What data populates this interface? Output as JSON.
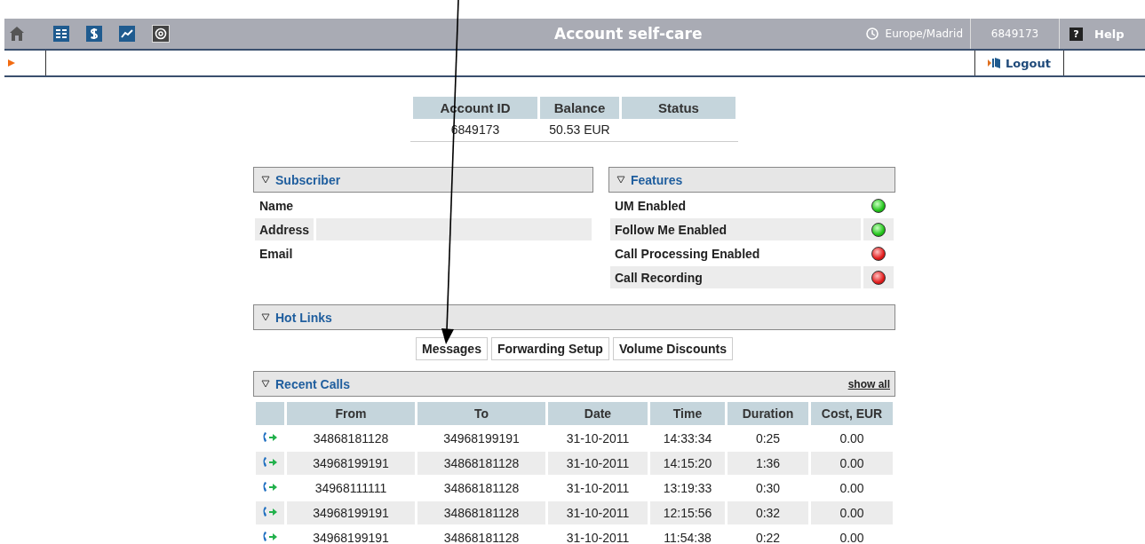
{
  "top_bar": {
    "title": "Account self-care",
    "timezone": "Europe/Madrid",
    "account": "6849173",
    "help_icon": "?",
    "help": "Help"
  },
  "nav_bar": {
    "logout": "Logout"
  },
  "summary": {
    "columns": [
      "Account ID",
      "Balance",
      "Status"
    ],
    "values": [
      "6849173",
      "50.53 EUR"
    ]
  },
  "subscriber": {
    "title": "Subscriber",
    "fields": [
      "Name",
      "Address",
      "Email"
    ]
  },
  "features": {
    "title": "Features",
    "items": [
      {
        "label": "UM Enabled",
        "enabled": true
      },
      {
        "label": "Follow Me Enabled",
        "enabled": true
      },
      {
        "label": "Call Processing Enabled",
        "enabled": false
      },
      {
        "label": "Call Recording",
        "enabled": false
      }
    ]
  },
  "hot_links": {
    "title": "Hot Links",
    "links": [
      "Messages",
      "Forwarding Setup",
      "Volume Discounts"
    ]
  },
  "recent_calls": {
    "title": "Recent Calls",
    "show_all": "show all",
    "columns": [
      "From",
      "To",
      "Date",
      "Time",
      "Duration",
      "Cost, EUR"
    ],
    "rows": [
      [
        "34868181128",
        "34968199191",
        "31-10-2011",
        "14:33:34",
        "0:25",
        "0.00"
      ],
      [
        "34968199191",
        "34868181128",
        "31-10-2011",
        "14:15:20",
        "1:36",
        "0.00"
      ],
      [
        "34968111111",
        "34868181128",
        "31-10-2011",
        "13:19:33",
        "0:30",
        "0.00"
      ],
      [
        "34968199191",
        "34868181128",
        "31-10-2011",
        "12:15:56",
        "0:32",
        "0.00"
      ],
      [
        "34968199191",
        "34868181128",
        "31-10-2011",
        "11:54:38",
        "0:22",
        "0.00"
      ]
    ]
  }
}
